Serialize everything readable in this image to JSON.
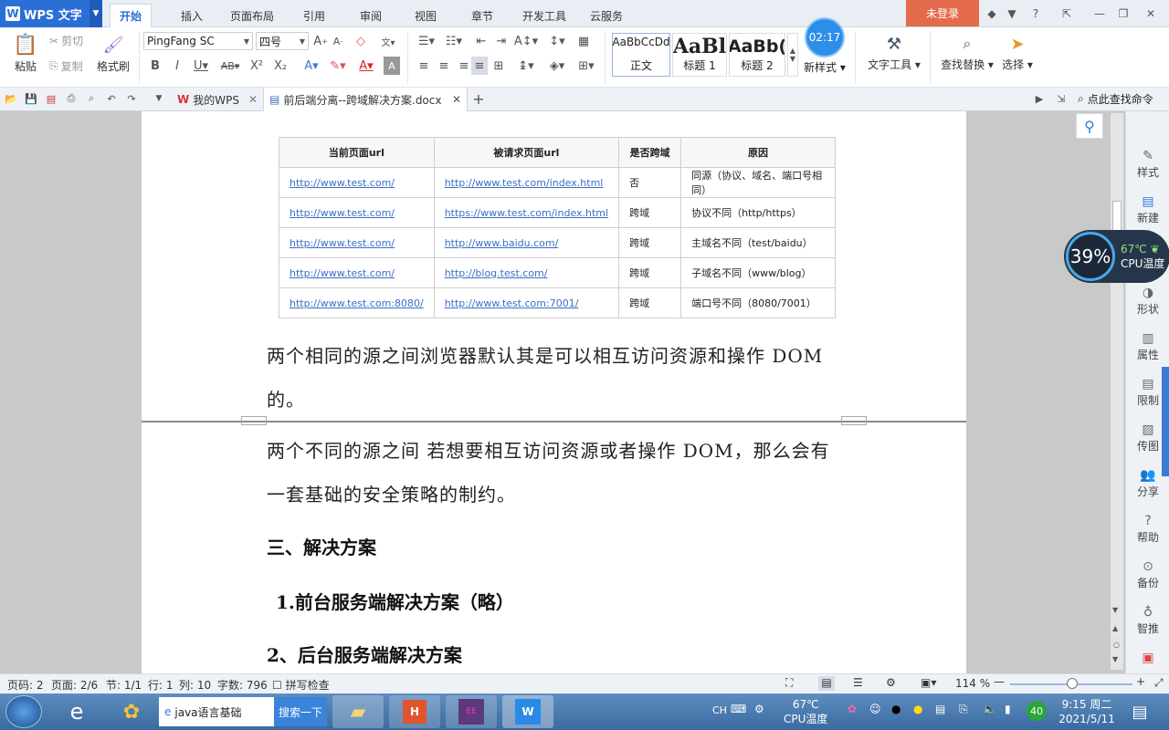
{
  "titlebar": {
    "app_name": "WPS 文字",
    "menu_tabs": [
      "开始",
      "插入",
      "页面布局",
      "引用",
      "审阅",
      "视图",
      "章节",
      "开发工具",
      "云服务"
    ],
    "login": "未登录"
  },
  "ribbon": {
    "paste": "粘贴",
    "cut": "剪切",
    "copy": "复制",
    "format_painter": "格式刷",
    "font_name": "PingFang SC",
    "font_size": "四号",
    "styles": [
      {
        "preview": "AaBbCcDd",
        "label": "正文"
      },
      {
        "preview": "AaBl",
        "label": "标题 1"
      },
      {
        "preview": "AaBb(",
        "label": "标题 2"
      }
    ],
    "new_style": "新样式",
    "text_tools": "文字工具",
    "find_replace": "查找替换",
    "select": "选择",
    "clock": "02:17"
  },
  "doctabs": {
    "mywps": "我的WPS",
    "doc": "前后端分离--跨域解决方案.docx",
    "search_cmd": "点此查找命令"
  },
  "table": {
    "headers": [
      "当前页面url",
      "被请求页面url",
      "是否跨域",
      "原因"
    ],
    "rows": [
      [
        "http://www.test.com/",
        "http://www.test.com/index.html",
        "否",
        "同源（协议、域名、端口号相同）"
      ],
      [
        "http://www.test.com/",
        "https://www.test.com/index.html",
        "跨域",
        "协议不同（http/https）"
      ],
      [
        "http://www.test.com/",
        "http://www.baidu.com/",
        "跨域",
        "主域名不同（test/baidu）"
      ],
      [
        "http://www.test.com/",
        "http://blog.test.com/",
        "跨域",
        "子域名不同（www/blog）"
      ],
      [
        "http://www.test.com:8080/",
        "http://www.test.com:7001/",
        "跨域",
        "端口号不同（8080/7001）"
      ]
    ]
  },
  "doc": {
    "para1_line1": "两个相同的源之间浏览器默认其是可以相互访问资源和操作 DOM",
    "para1_line2": "的。",
    "para2_line1": "两个不同的源之间 若想要相互访问资源或者操作 DOM，那么会有",
    "para2_line2": "一套基础的安全策略的制约。",
    "heading3": "三、解决方案",
    "heading_1": "1.前台服务端解决方案（略）",
    "heading_2": "2、后台服务端解决方案"
  },
  "sidebar": [
    "样式",
    "新建",
    "形状",
    "属性",
    "限制",
    "传图",
    "分享",
    "帮助",
    "备份",
    "智推"
  ],
  "cpu": {
    "percent": "39%",
    "temp": "67℃",
    "label": "CPU温度"
  },
  "statusbar": {
    "page_code": "页码: 2",
    "page": "页面: 2/6",
    "section": "节: 1/1",
    "row": "行: 1",
    "col": "列: 10",
    "words": "字数: 796",
    "spell": "拼写检查",
    "zoom": "114 %"
  },
  "taskbar": {
    "ie_tab": "java语言基础",
    "search_btn": "搜索一下",
    "ime": "CH",
    "temp": "67℃",
    "temp_label": "CPU温度",
    "battery": "40",
    "time": "9:15 周二",
    "date": "2021/5/11"
  }
}
